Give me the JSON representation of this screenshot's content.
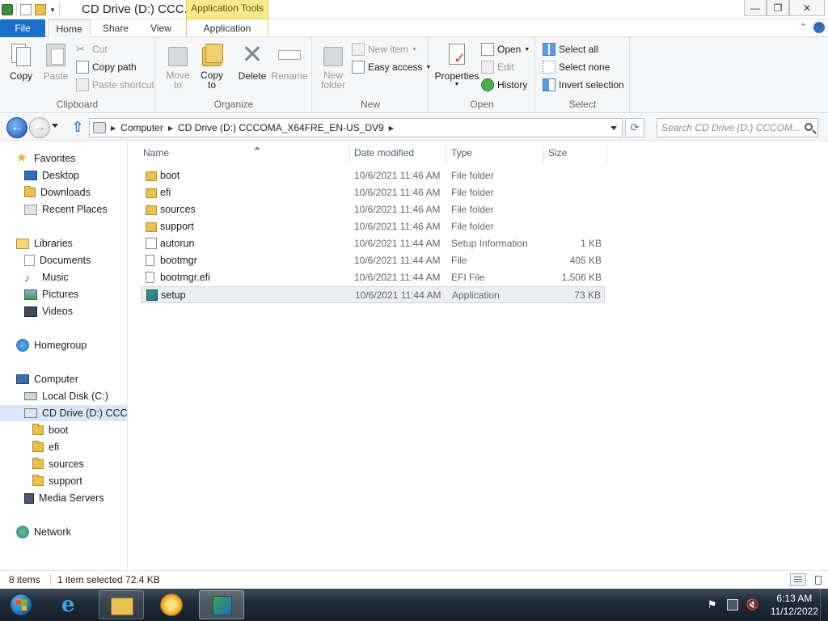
{
  "window": {
    "title": "CD Drive (D:) CCC...",
    "context_tab": "Application Tools",
    "minimize": "—",
    "maximize": "❐",
    "close": "✕"
  },
  "tabs": {
    "file": "File",
    "home": "Home",
    "share": "Share",
    "view": "View",
    "application": "Application"
  },
  "ribbon": {
    "clipboard": {
      "label": "Clipboard",
      "copy": "Copy",
      "paste": "Paste",
      "cut": "Cut",
      "copy_path": "Copy path",
      "paste_shortcut": "Paste shortcut"
    },
    "organize": {
      "label": "Organize",
      "move_to_1": "Move",
      "move_to_2": "to",
      "copy_to_1": "Copy",
      "copy_to_2": "to",
      "delete": "Delete",
      "rename": "Rename"
    },
    "new": {
      "label": "New",
      "new_folder_1": "New",
      "new_folder_2": "folder",
      "new_item": "New item",
      "easy_access": "Easy access"
    },
    "open": {
      "label": "Open",
      "properties": "Properties",
      "open": "Open",
      "edit": "Edit",
      "history": "History"
    },
    "select": {
      "label": "Select",
      "select_all": "Select all",
      "select_none": "Select none",
      "invert_selection": "Invert selection"
    }
  },
  "address": {
    "crumbs": [
      "Computer",
      "CD Drive (D:) CCCOMA_X64FRE_EN-US_DV9"
    ],
    "search_placeholder": "Search CD Drive (D:) CCCOM..."
  },
  "nav": {
    "favorites": "Favorites",
    "desktop": "Desktop",
    "downloads": "Downloads",
    "recent_places": "Recent Places",
    "libraries": "Libraries",
    "documents": "Documents",
    "music": "Music",
    "pictures": "Pictures",
    "videos": "Videos",
    "homegroup": "Homegroup",
    "computer": "Computer",
    "local_disk": "Local Disk (C:)",
    "cd_drive": "CD Drive (D:) CCCOI",
    "boot": "boot",
    "efi": "efi",
    "sources": "sources",
    "support": "support",
    "media_servers": "Media Servers",
    "network": "Network"
  },
  "columns": {
    "name": "Name",
    "date": "Date modified",
    "type": "Type",
    "size": "Size"
  },
  "files": [
    {
      "name": "boot",
      "date": "10/6/2021 11:46 AM",
      "type": "File folder",
      "size": "",
      "icon": "folder-icon"
    },
    {
      "name": "efi",
      "date": "10/6/2021 11:46 AM",
      "type": "File folder",
      "size": "",
      "icon": "folder-icon"
    },
    {
      "name": "sources",
      "date": "10/6/2021 11:46 AM",
      "type": "File folder",
      "size": "",
      "icon": "folder-icon"
    },
    {
      "name": "support",
      "date": "10/6/2021 11:46 AM",
      "type": "File folder",
      "size": "",
      "icon": "folder-icon"
    },
    {
      "name": "autorun",
      "date": "10/6/2021 11:44 AM",
      "type": "Setup Information",
      "size": "1 KB",
      "icon": "setup-info-icon"
    },
    {
      "name": "bootmgr",
      "date": "10/6/2021 11:44 AM",
      "type": "File",
      "size": "405 KB",
      "icon": "file-icon"
    },
    {
      "name": "bootmgr.efi",
      "date": "10/6/2021 11:44 AM",
      "type": "EFI File",
      "size": "1,506 KB",
      "icon": "file-icon"
    },
    {
      "name": "setup",
      "date": "10/6/2021 11:44 AM",
      "type": "Application",
      "size": "73 KB",
      "icon": "setup-app-icon"
    }
  ],
  "status": {
    "count": "8 items",
    "selection": "1 item selected  72.4 KB"
  },
  "taskbar": {
    "time": "6:13 AM",
    "date": "11/12/2022"
  },
  "colors": {
    "file_tab": "#1a6fcb",
    "context_tab": "#f7e98c",
    "selection": "#d9e8fb"
  }
}
